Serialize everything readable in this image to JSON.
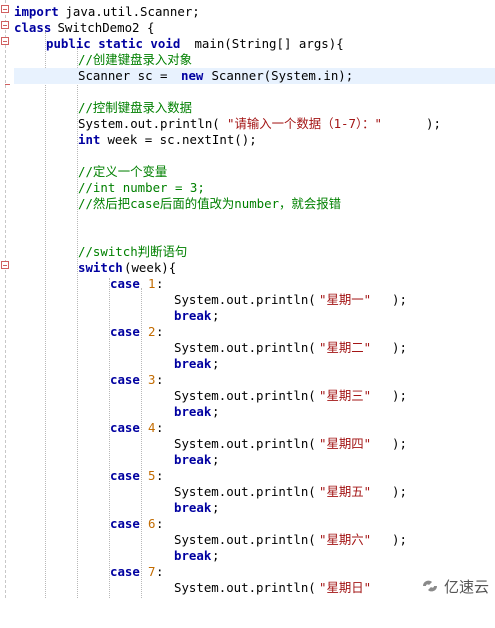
{
  "code": {
    "l1": [
      "import",
      " java.util.Scanner;"
    ],
    "l2": [
      "class",
      " SwitchDemo2 {"
    ],
    "l3": [
      "public static void",
      " main(String[] args){"
    ],
    "l4": [
      "//创建键盘录入对象"
    ],
    "l5": [
      "Scanner sc = ",
      "new",
      " Scanner(System.in);"
    ],
    "l7": [
      "//控制键盘录入数据"
    ],
    "l8": [
      "System.out.println(",
      "\"请输入一个数据（1-7）：\"",
      ");"
    ],
    "l9": [
      "int",
      " week = sc.nextInt();"
    ],
    "l11": [
      "//定义一个变量"
    ],
    "l12": [
      "//int number = 3;"
    ],
    "l13": [
      "//然后把case后面的值改为number，就会报错"
    ],
    "l16": [
      "//switch判断语句"
    ],
    "l17": [
      "switch",
      "(week){"
    ],
    "cases": [
      {
        "kw": "case",
        "num": "1",
        "colon": ":",
        "pre": "System.out.println(",
        "str": "\"星期一\"",
        "post": ");",
        "brk": "break",
        "semi": ";"
      },
      {
        "kw": "case",
        "num": "2",
        "colon": ":",
        "pre": "System.out.println(",
        "str": "\"星期二\"",
        "post": ");",
        "brk": "break",
        "semi": ";"
      },
      {
        "kw": "case",
        "num": "3",
        "colon": ":",
        "pre": "System.out.println(",
        "str": "\"星期三\"",
        "post": ");",
        "brk": "break",
        "semi": ";"
      },
      {
        "kw": "case",
        "num": "4",
        "colon": ":",
        "pre": "System.out.println(",
        "str": "\"星期四\"",
        "post": ");",
        "brk": "break",
        "semi": ";"
      },
      {
        "kw": "case",
        "num": "5",
        "colon": ":",
        "pre": "System.out.println(",
        "str": "\"星期五\"",
        "post": ");",
        "brk": "break",
        "semi": ";"
      },
      {
        "kw": "case",
        "num": "6",
        "colon": ":",
        "pre": "System.out.println(",
        "str": "\"星期六\"",
        "post": ");",
        "brk": "break",
        "semi": ";"
      },
      {
        "kw": "case",
        "num": "7",
        "colon": ":",
        "pre": "System.out.println(",
        "str": "\"星期日\"",
        "post": ""
      }
    ]
  },
  "watermark": {
    "text": "亿速云",
    "icon": "yisu-logo-icon"
  },
  "colors": {
    "keyword": "#0000a0",
    "comment": "#008000",
    "string": "#a31515",
    "number": "#c26b00",
    "current_line": "#e8f2fe"
  }
}
